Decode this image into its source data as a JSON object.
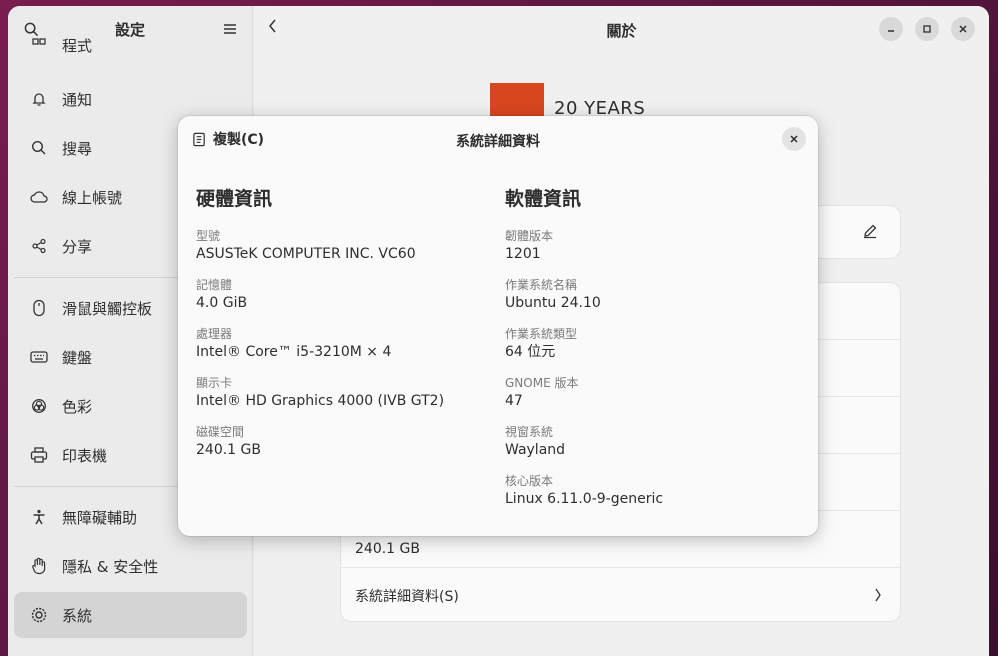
{
  "sidebar": {
    "title": "設定",
    "items": [
      {
        "label": "程式",
        "icon": "apps-icon"
      },
      {
        "label": "通知",
        "icon": "bell-icon"
      },
      {
        "label": "搜尋",
        "icon": "search-icon"
      },
      {
        "label": "線上帳號",
        "icon": "cloud-icon"
      },
      {
        "label": "分享",
        "icon": "share-icon"
      },
      {
        "label": "滑鼠與觸控板",
        "icon": "mouse-icon"
      },
      {
        "label": "鍵盤",
        "icon": "keyboard-icon"
      },
      {
        "label": "色彩",
        "icon": "color-icon"
      },
      {
        "label": "印表機",
        "icon": "printer-icon"
      },
      {
        "label": "無障礙輔助",
        "icon": "accessibility-icon"
      },
      {
        "label": "隱私 & 安全性",
        "icon": "hand-icon"
      },
      {
        "label": "系統",
        "icon": "gear-icon"
      }
    ]
  },
  "content": {
    "title": "關於",
    "logo_text": "20 YEARS",
    "disk_value": "240.1 GB",
    "system_details_label": "系統詳細資料(S)"
  },
  "dialog": {
    "title": "系統詳細資料",
    "copy_label": "複製(C)",
    "hardware": {
      "heading": "硬體資訊",
      "fields": [
        {
          "label": "型號",
          "value": "ASUSTeK COMPUTER INC. VC60"
        },
        {
          "label": "記憶體",
          "value": "4.0 GiB"
        },
        {
          "label": "處理器",
          "value": "Intel® Core™ i5-3210M × 4"
        },
        {
          "label": "顯示卡",
          "value": "Intel® HD Graphics 4000 (IVB GT2)"
        },
        {
          "label": "磁碟空間",
          "value": "240.1 GB"
        }
      ]
    },
    "software": {
      "heading": "軟體資訊",
      "fields": [
        {
          "label": "韌體版本",
          "value": "1201"
        },
        {
          "label": "作業系統名稱",
          "value": "Ubuntu 24.10"
        },
        {
          "label": "作業系統類型",
          "value": "64 位元"
        },
        {
          "label": "GNOME 版本",
          "value": "47"
        },
        {
          "label": "視窗系統",
          "value": "Wayland"
        },
        {
          "label": "核心版本",
          "value": "Linux 6.11.0-9-generic"
        }
      ]
    }
  }
}
